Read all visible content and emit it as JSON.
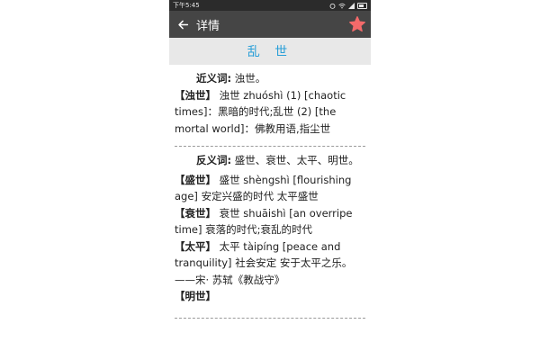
{
  "status_bar": {
    "time": "下午5:45"
  },
  "app_bar": {
    "title": "详情"
  },
  "word": "乱 世",
  "synonyms": {
    "label": "近义词:",
    "list_text": "浊世。",
    "entries": [
      {
        "head": "【浊世】",
        "body": "浊世 zhuóshì (1) [chaotic times]：黑暗的时代;乱世 (2) [the mortal world]：佛教用语,指尘世"
      }
    ]
  },
  "antonyms": {
    "label": "反义词:",
    "list_text": "盛世、衰世、太平、明世。",
    "entries": [
      {
        "head": "【盛世】",
        "body": "盛世 shèngshì [flourishing age] 安定兴盛的时代 太平盛世"
      },
      {
        "head": "【衰世】",
        "body": "衰世 shuāishì [an overripe time] 衰落的时代;衰乱的时代"
      },
      {
        "head": "【太平】",
        "body": "太平 tàipíng [peace and tranquility] 社会安定 安于太平之乐。——宋· 苏轼《教战守》"
      },
      {
        "head": "【明世】",
        "body": ""
      }
    ]
  },
  "colors": {
    "accent": "#2a9fd8",
    "appbar": "#454545",
    "favorite": "#f36a6a"
  },
  "icons": {
    "back": "back-arrow-icon",
    "favorite": "star-icon"
  }
}
